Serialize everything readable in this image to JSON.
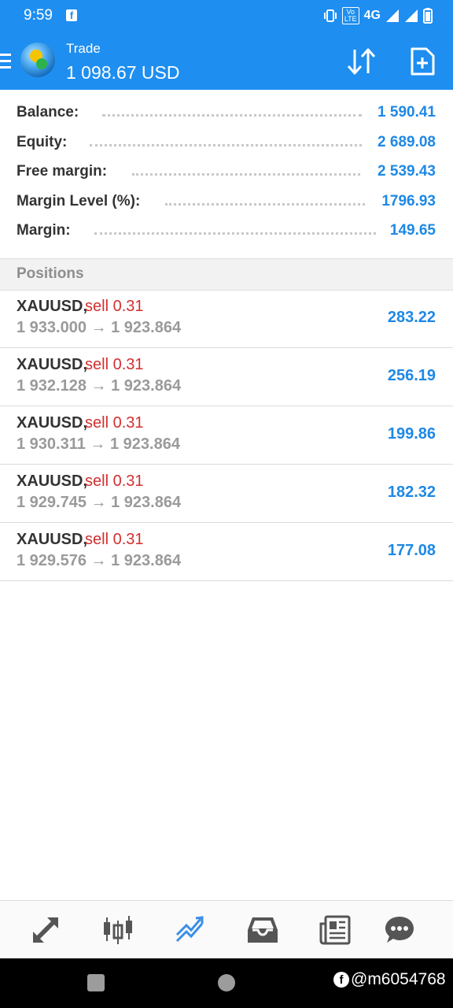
{
  "status_bar": {
    "time": "9:59",
    "network": "4G",
    "volte": "Vo\nLTE"
  },
  "app_bar": {
    "title": "Trade",
    "subtitle": "1 098.67 USD"
  },
  "summary": [
    {
      "label": "Balance:",
      "value": "1 590.41"
    },
    {
      "label": "Equity:",
      "value": "2 689.08"
    },
    {
      "label": "Free margin:",
      "value": "2 539.43"
    },
    {
      "label": "Margin Level (%):",
      "value": "1796.93"
    },
    {
      "label": "Margin:",
      "value": "149.65"
    }
  ],
  "positions_header": "Positions",
  "positions": [
    {
      "symbol": "XAUUSD,",
      "direction": "sell 0.31",
      "prices": "1 933.000 → 1 923.864",
      "profit": "283.22"
    },
    {
      "symbol": "XAUUSD,",
      "direction": "sell 0.31",
      "prices": "1 932.128 → 1 923.864",
      "profit": "256.19"
    },
    {
      "symbol": "XAUUSD,",
      "direction": "sell 0.31",
      "prices": "1 930.311 → 1 923.864",
      "profit": "199.86"
    },
    {
      "symbol": "XAUUSD,",
      "direction": "sell 0.31",
      "prices": "1 929.745 → 1 923.864",
      "profit": "182.32"
    },
    {
      "symbol": "XAUUSD,",
      "direction": "sell 0.31",
      "prices": "1 929.576 → 1 923.864",
      "profit": "177.08"
    }
  ],
  "tabs": [
    {
      "icon": "quotes-arrows-icon",
      "active": false
    },
    {
      "icon": "candlestick-chart-icon",
      "active": false
    },
    {
      "icon": "trade-trend-icon",
      "active": true
    },
    {
      "icon": "inbox-history-icon",
      "active": false
    },
    {
      "icon": "news-icon",
      "active": false
    },
    {
      "icon": "chat-icon",
      "active": false
    }
  ],
  "colors": {
    "primary": "#1e8ef0",
    "profit": "#1e88e5",
    "sell": "#d32f2f",
    "muted": "#9a9a9a"
  },
  "watermark": "@m6054768"
}
